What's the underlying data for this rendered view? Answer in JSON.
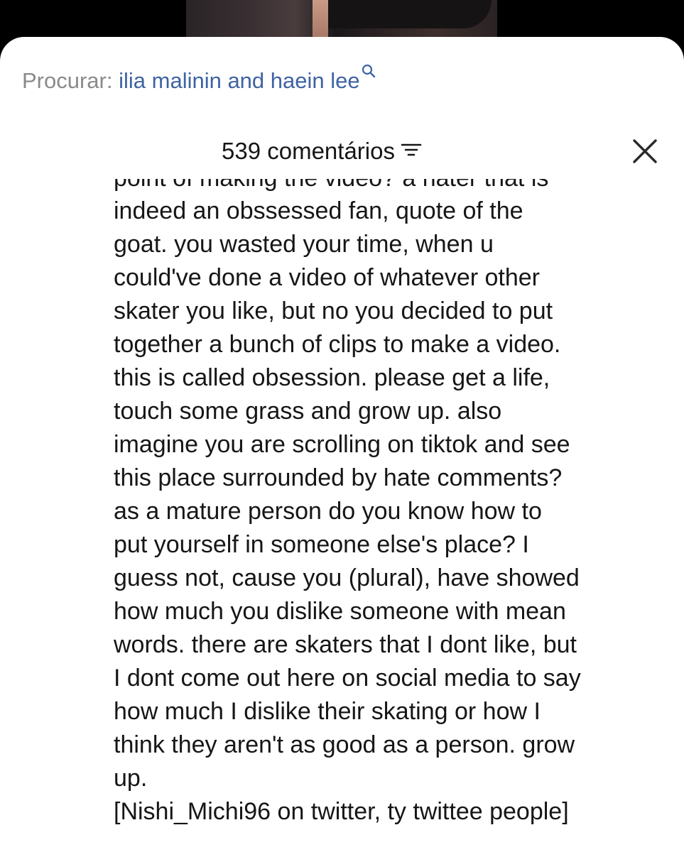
{
  "search": {
    "prefix": "Procurar:",
    "query": "ilia malinin and haein lee"
  },
  "comments_header": {
    "count_label": "539 comentários"
  },
  "comment": {
    "cut_off_line": "point of making the video? a hater that is",
    "lines": [
      "indeed an obssessed fan, quote of the",
      "goat. you wasted your time, when u",
      "could've done a video of whatever other",
      "skater you like, but no you decided to put",
      "together a bunch of clips to make a video.",
      "this is called obsession. please get a life,",
      "touch some grass and grow up. also",
      "imagine you are scrolling on tiktok and see",
      "this place surrounded by hate comments?",
      "as a mature person do you know how to",
      "put yourself in someone else's place? I",
      "guess not, cause you (plural), have showed",
      "how much you dislike someone with mean",
      "words. there are skaters that I dont like, but",
      "I dont come out here on social media to say",
      "how much I dislike their skating or how I",
      "think they aren't as good as a person. grow",
      "up.",
      "[Nishi_Michi96 on twitter, ty twittee people]"
    ]
  },
  "colors": {
    "search_query": "#3e63a3",
    "search_prefix": "#8a8a8a",
    "text": "#161616",
    "sheet_background": "#ffffff"
  },
  "icons": {
    "search": "search-icon",
    "sort": "filter-sort-icon",
    "close": "close-icon"
  }
}
